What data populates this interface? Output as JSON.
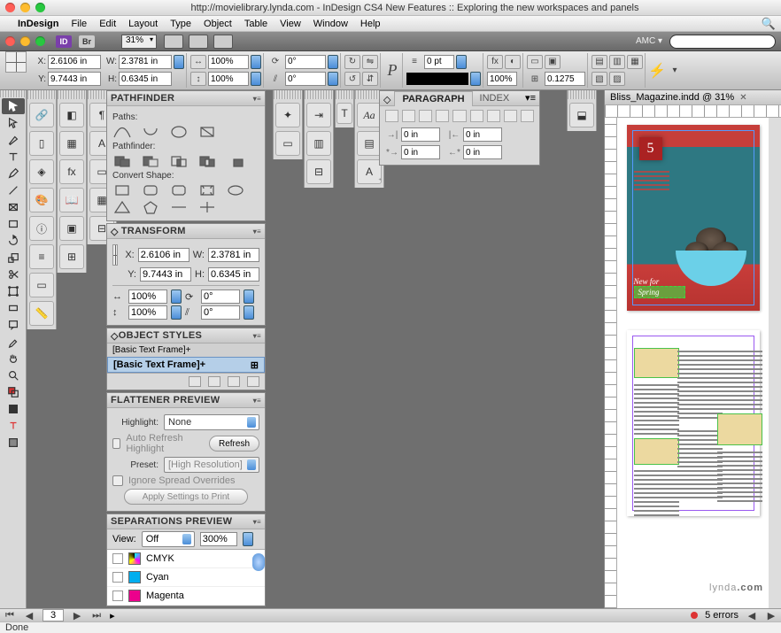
{
  "window": {
    "title": "http://movielibrary.lynda.com - InDesign CS4 New Features :: Exploring the new workspaces and panels"
  },
  "menubar": {
    "app": "InDesign",
    "items": [
      "File",
      "Edit",
      "Layout",
      "Type",
      "Object",
      "Table",
      "View",
      "Window",
      "Help"
    ]
  },
  "appbar": {
    "id_badge": "ID",
    "br_badge": "Br",
    "zoom": "31%",
    "workspace": "AMC ▾"
  },
  "control": {
    "x": "2.6106 in",
    "y": "9.7443 in",
    "w": "2.3781 in",
    "h": "0.6345 in",
    "scale_x": "100%",
    "scale_y": "100%",
    "rotate": "0°",
    "shear": "0°",
    "stroke_pt": "0 pt",
    "fx_pct": "100%",
    "inset": "0.1275"
  },
  "pathfinder": {
    "title": "PATHFINDER",
    "paths_label": "Paths:",
    "pf_label": "Pathfinder:",
    "convert_label": "Convert Shape:"
  },
  "transform": {
    "title": "TRANSFORM",
    "x": "2.6106 in",
    "y": "9.7443 in",
    "w": "2.3781 in",
    "h": "0.6345 in",
    "sx": "100%",
    "sy": "100%",
    "rot": "0°",
    "shear": "0°"
  },
  "object_styles": {
    "title": "OBJECT STYLES",
    "row1": "[Basic Text Frame]+",
    "row2": "[Basic Text Frame]+"
  },
  "flattener": {
    "title": "FLATTENER PREVIEW",
    "highlight_label": "Highlight:",
    "highlight_value": "None",
    "auto_refresh": "Auto Refresh Highlight",
    "refresh_btn": "Refresh",
    "preset_label": "Preset:",
    "preset_value": "[High Resolution]",
    "ignore": "Ignore Spread Overrides",
    "apply": "Apply Settings to Print"
  },
  "separations": {
    "title": "SEPARATIONS PREVIEW",
    "view_label": "View:",
    "view_value": "Off",
    "pct": "300%",
    "items": [
      {
        "name": "CMYK",
        "color": "linear-gradient(45deg,#0ff,#f0f,#ff0,#000)"
      },
      {
        "name": "Cyan",
        "color": "#00aeef"
      },
      {
        "name": "Magenta",
        "color": "#ec008c"
      }
    ]
  },
  "paragraph": {
    "tab1": "PARAGRAPH",
    "tab2": "INDEX",
    "left_indent": "0 in",
    "right_indent": "0 in",
    "first_line": "0 in",
    "last_line": "0 in"
  },
  "doc": {
    "tab": "Bliss_Magazine.indd @ 31%",
    "badge_num": "5",
    "spring1": "New for",
    "spring2": "Spring"
  },
  "status": {
    "page": "3",
    "errors": "5 errors",
    "open_icon": "▸"
  },
  "footer": {
    "text": "Done"
  },
  "watermark": {
    "brand": "lynda",
    "suffix": ".com"
  }
}
